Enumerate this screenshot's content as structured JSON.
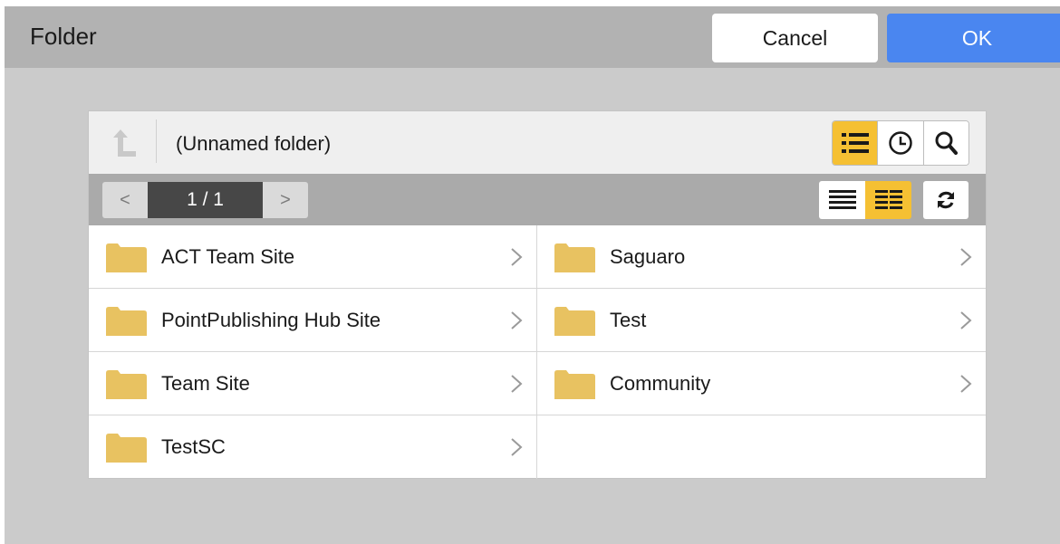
{
  "dialog": {
    "title": "Folder",
    "cancel_label": "Cancel",
    "ok_label": "OK"
  },
  "toolbar": {
    "path": "(Unnamed folder)",
    "up_icon": "up-arrow-icon",
    "view_buttons": [
      {
        "icon": "list-icon",
        "active": true
      },
      {
        "icon": "clock-icon",
        "active": false
      },
      {
        "icon": "search-icon",
        "active": false
      }
    ]
  },
  "pager": {
    "prev": "<",
    "page": "1 / 1",
    "next": ">",
    "layout_buttons": [
      {
        "icon": "list-layout-icon",
        "active": false
      },
      {
        "icon": "grid-layout-icon",
        "active": true
      }
    ],
    "refresh_icon": "refresh-icon"
  },
  "items": [
    {
      "name": "ACT Team Site"
    },
    {
      "name": "Saguaro"
    },
    {
      "name": "PointPublishing Hub Site"
    },
    {
      "name": "Test"
    },
    {
      "name": "Team Site"
    },
    {
      "name": "Community"
    },
    {
      "name": "TestSC"
    }
  ],
  "colors": {
    "accent": "#f5c033",
    "ok_button": "#4a86f0",
    "folder": "#e8c261"
  }
}
